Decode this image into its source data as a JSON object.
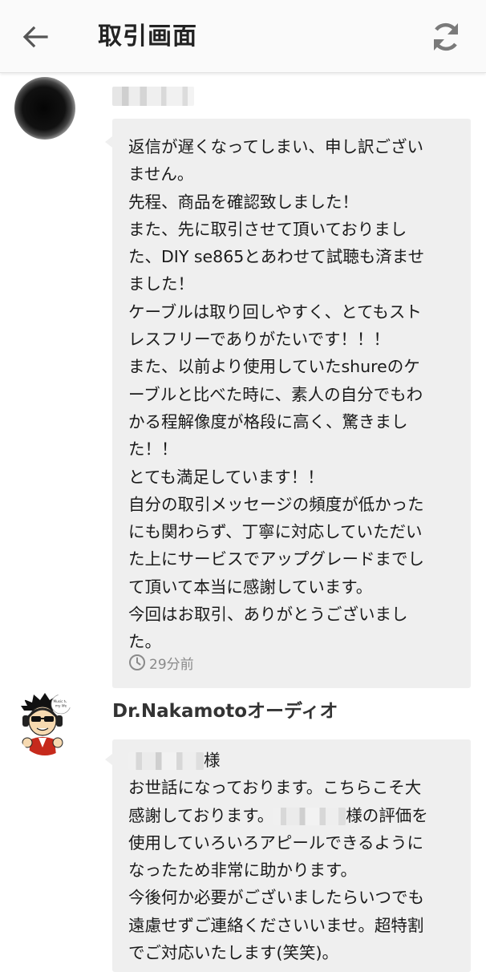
{
  "header": {
    "title": "取引画面",
    "back_icon": "arrow-left-icon",
    "refresh_icon": "refresh-icon"
  },
  "messages": [
    {
      "sender": "",
      "lines": [
        "返信が遅くなってしまい、申し訳ござい",
        "ません。",
        "先程、商品を確認致しました！",
        "また、先に取引させて頂いておりまし",
        "た、DIY se865とあわせて試聴も済ませ",
        "ました！",
        "ケーブルは取り回しやすく、とてもスト",
        "レスフリーでありがたいです！！！",
        "また、以前より使用していたshureのケ",
        "ーブルと比べた時に、素人の自分でもわ",
        "かる程解像度が格段に高く、驚きまし",
        "た！！",
        "とても満足しています！！",
        "自分の取引メッセージの頻度が低かった",
        "にも関わらず、丁寧に対応していただい",
        "た上にサービスでアップグレードまでし",
        "て頂いて本当に感謝しています。",
        "今回はお取引、ありがとうございまし",
        "た。"
      ],
      "timestamp": "29分前"
    },
    {
      "sender": "Dr.Nakamotoオーディオ",
      "line1_suffix": "様",
      "line2": "お世話になっております。こちらこそ大",
      "line3_prefix": "感謝しております。",
      "line3_suffix": "様の評価を",
      "lines_rest": [
        "使用していろいろアピールできるように",
        "なったため非常に助かります。",
        "今後何か必要がございましたらいつでも",
        "遠慮せずご連絡くださいいませ。超特割",
        "でご対応いたします(笑笑)。"
      ],
      "avatar_caption": "Music for my life"
    }
  ],
  "colors": {
    "header_bg": "#fafafa",
    "bubble_bg": "#efefef",
    "timestamp": "#8a8a8a"
  }
}
